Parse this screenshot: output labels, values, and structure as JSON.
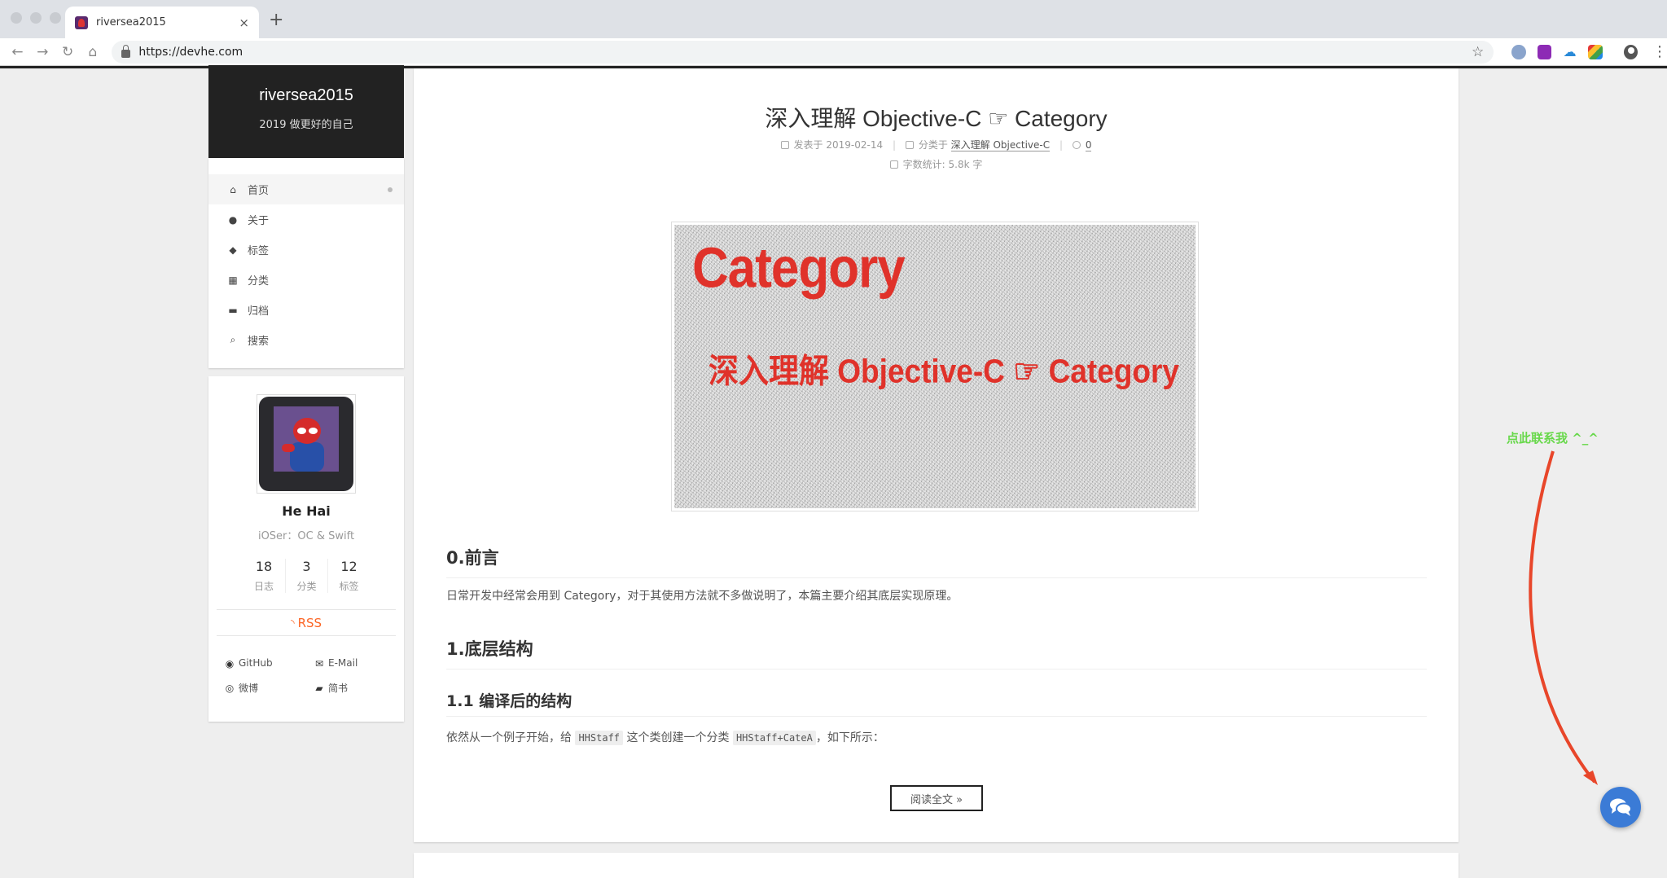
{
  "browser": {
    "tab_title": "riversea2015",
    "tab_close": "×",
    "new_tab": "+",
    "url": "https://devhe.com",
    "star": "☆",
    "kebab": "⋮"
  },
  "site": {
    "title": "riversea2015",
    "subtitle": "2019 做更好的自己"
  },
  "menu": [
    {
      "label": "首页",
      "icon": "home-icon",
      "glyph": "⌂"
    },
    {
      "label": "关于",
      "icon": "user-icon",
      "glyph": "●"
    },
    {
      "label": "标签",
      "icon": "tags-icon",
      "glyph": "◆"
    },
    {
      "label": "分类",
      "icon": "th-icon",
      "glyph": "▦"
    },
    {
      "label": "归档",
      "icon": "archive-icon",
      "glyph": "▬"
    },
    {
      "label": "搜索",
      "icon": "search-icon",
      "glyph": "⌕"
    }
  ],
  "author": {
    "name": "He Hai",
    "description": "iOSer：OC & Swift",
    "stats": [
      {
        "num": "18",
        "label": "日志"
      },
      {
        "num": "3",
        "label": "分类"
      },
      {
        "num": "12",
        "label": "标签"
      }
    ],
    "rss": "RSS",
    "links": [
      {
        "label": "GitHub",
        "icon": "github-icon",
        "glyph": "◉"
      },
      {
        "label": "E-Mail",
        "icon": "envelope-icon",
        "glyph": "✉"
      },
      {
        "label": "微博",
        "icon": "weibo-icon",
        "glyph": "◎"
      },
      {
        "label": "简书",
        "icon": "book-icon",
        "glyph": "▰"
      }
    ]
  },
  "post": {
    "title": "深入理解 Objective-C ☞ Category",
    "meta": {
      "posted_label": "发表于",
      "posted_date": "2019-02-14",
      "category_label": "分类于",
      "category": "深入理解 Objective-C",
      "comments": "0",
      "wordcount_label": "字数统计:",
      "wordcount": "5.8k 字"
    },
    "banner": {
      "big": "Category",
      "sub": "深入理解 Objective-C ☞ Category"
    },
    "h_intro": "0.前言",
    "p_intro": "日常开发中经常会用到 Category，对于其使用方法就不多做说明了，本篇主要介绍其底层实现原理。",
    "h_struct": "1.底层结构",
    "h_compiled": "1.1 编译后的结构",
    "p_example_a": "依然从一个例子开始，给",
    "code_a": "HHStaff",
    "p_example_b": "这个类创建一个分类",
    "code_b": "HHStaff+CateA",
    "p_example_c": "，如下所示：",
    "read_more": "阅读全文 »"
  },
  "contact": {
    "hint": "点此联系我 ^_^"
  },
  "colors": {
    "brand_bg": "#222222",
    "rss": "#fc6423",
    "hint_green": "#68d84b",
    "arrow_red": "#e8462a",
    "chat_blue": "#3b7bd6"
  }
}
